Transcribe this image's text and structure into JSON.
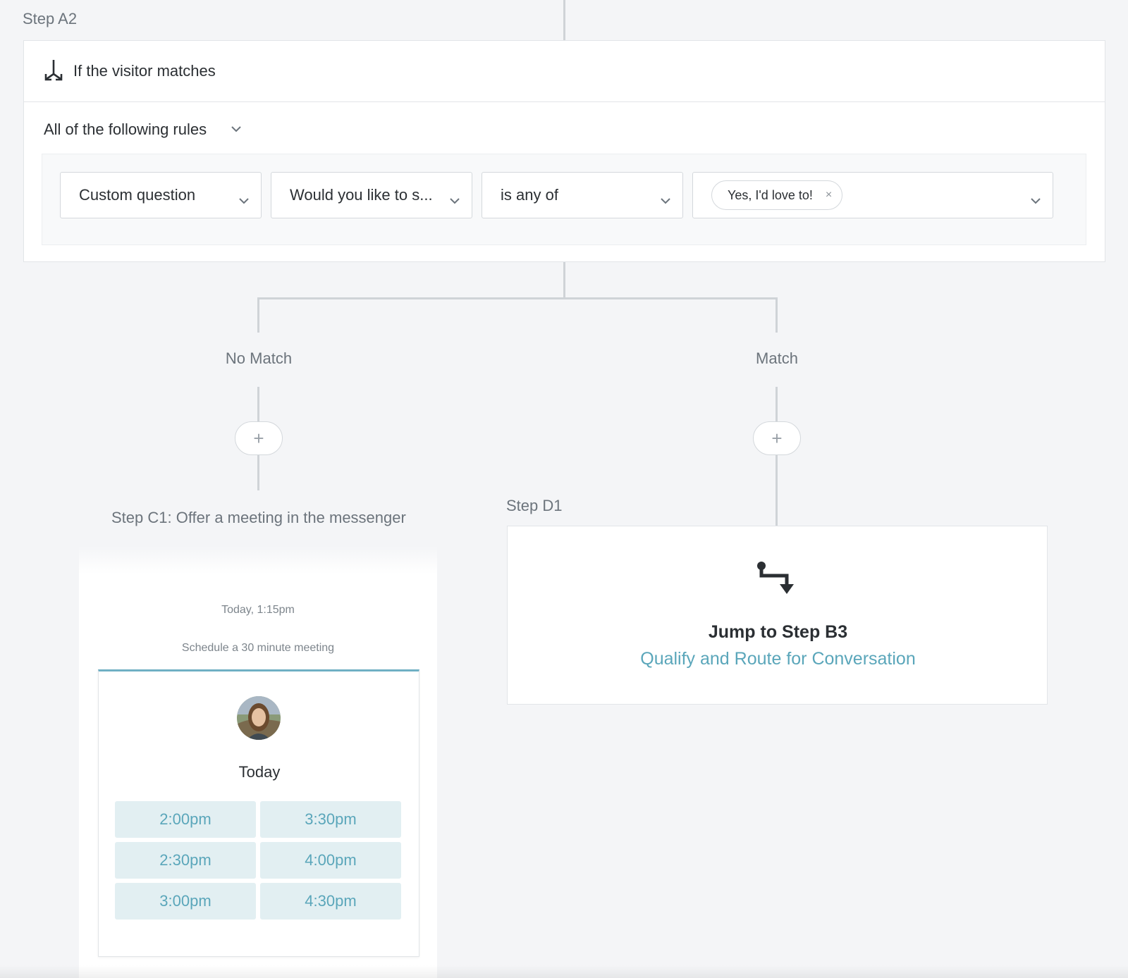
{
  "step_a2": {
    "label": "Step A2",
    "header_title": "If the visitor matches",
    "match_mode": "All of the following rules",
    "rule": {
      "field": "Custom question",
      "question": "Would you like to s...",
      "operator": "is any of",
      "values": [
        "Yes, I'd love to!"
      ],
      "remove_glyph": "×"
    }
  },
  "branches": {
    "no_match": "No Match",
    "match": "Match",
    "add_glyph": "+"
  },
  "step_c1": {
    "label": "Step C1: Offer a meeting in the messenger",
    "time": "Today, 1:15pm",
    "schedule_text": "Schedule a 30 minute meeting",
    "day": "Today",
    "slots": [
      "2:00pm",
      "3:30pm",
      "2:30pm",
      "4:00pm",
      "3:00pm",
      "4:30pm"
    ]
  },
  "step_d1": {
    "label": "Step D1",
    "title": "Jump to Step B3",
    "link": "Qualify and Route for Conversation"
  },
  "colors": {
    "accent": "#5aa6ba",
    "slot_bg": "#e2eff2",
    "connector": "#cfd3d7",
    "canvas_bg": "#f4f5f7"
  },
  "icons": {
    "branch": "split-branch-icon",
    "chevron": "chevron-down-icon",
    "jump": "jump-step-icon",
    "add": "plus-icon"
  }
}
